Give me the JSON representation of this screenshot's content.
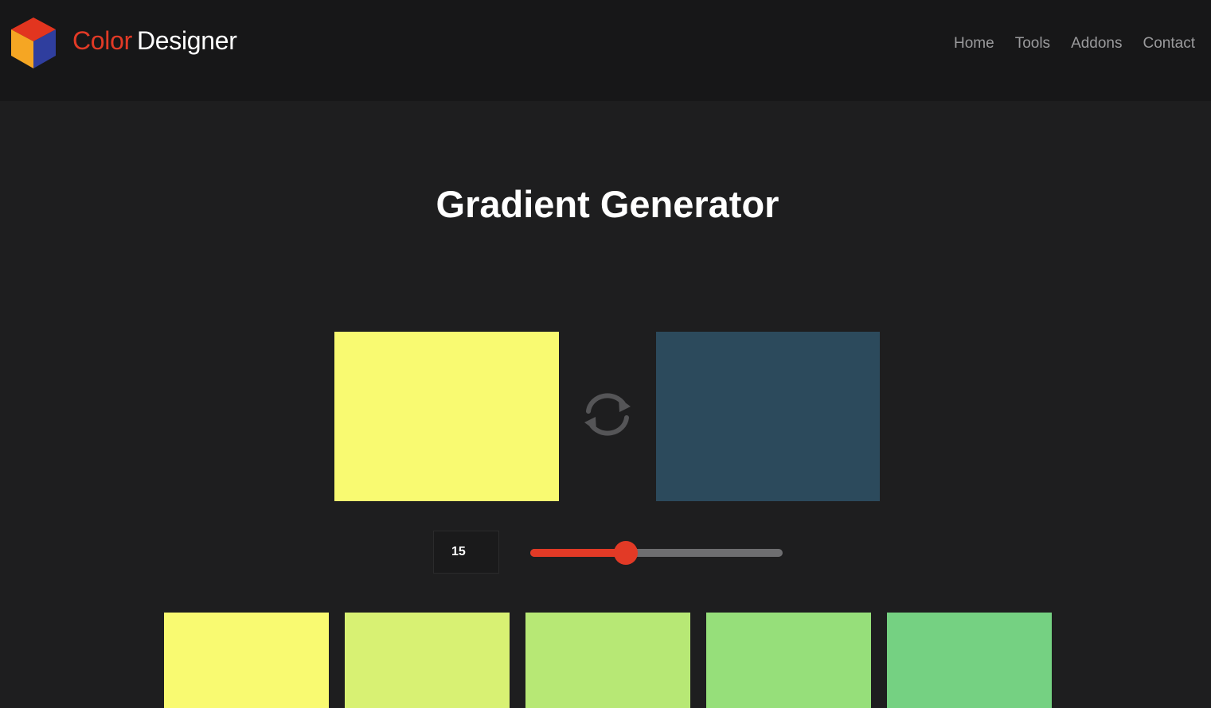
{
  "header": {
    "brand_part1": "Color",
    "brand_part2": "Designer",
    "logo_icon": "cube-logo-icon",
    "brand_red": "#e23a26",
    "nav": [
      {
        "label": "Home"
      },
      {
        "label": "Tools"
      },
      {
        "label": "Addons"
      },
      {
        "label": "Contact"
      }
    ]
  },
  "main": {
    "title": "Gradient Generator",
    "start_color": "#f9fa71",
    "end_color": "#2c4a5c",
    "swap_icon": "refresh-icon",
    "steps_value": "15",
    "slider_fraction": 0.38,
    "accent": "#e23a26",
    "swatches": [
      {
        "color": "#f9fa71"
      },
      {
        "color": "#d8f173"
      },
      {
        "color": "#b7e875"
      },
      {
        "color": "#96df7a"
      },
      {
        "color": "#75d182"
      }
    ]
  }
}
